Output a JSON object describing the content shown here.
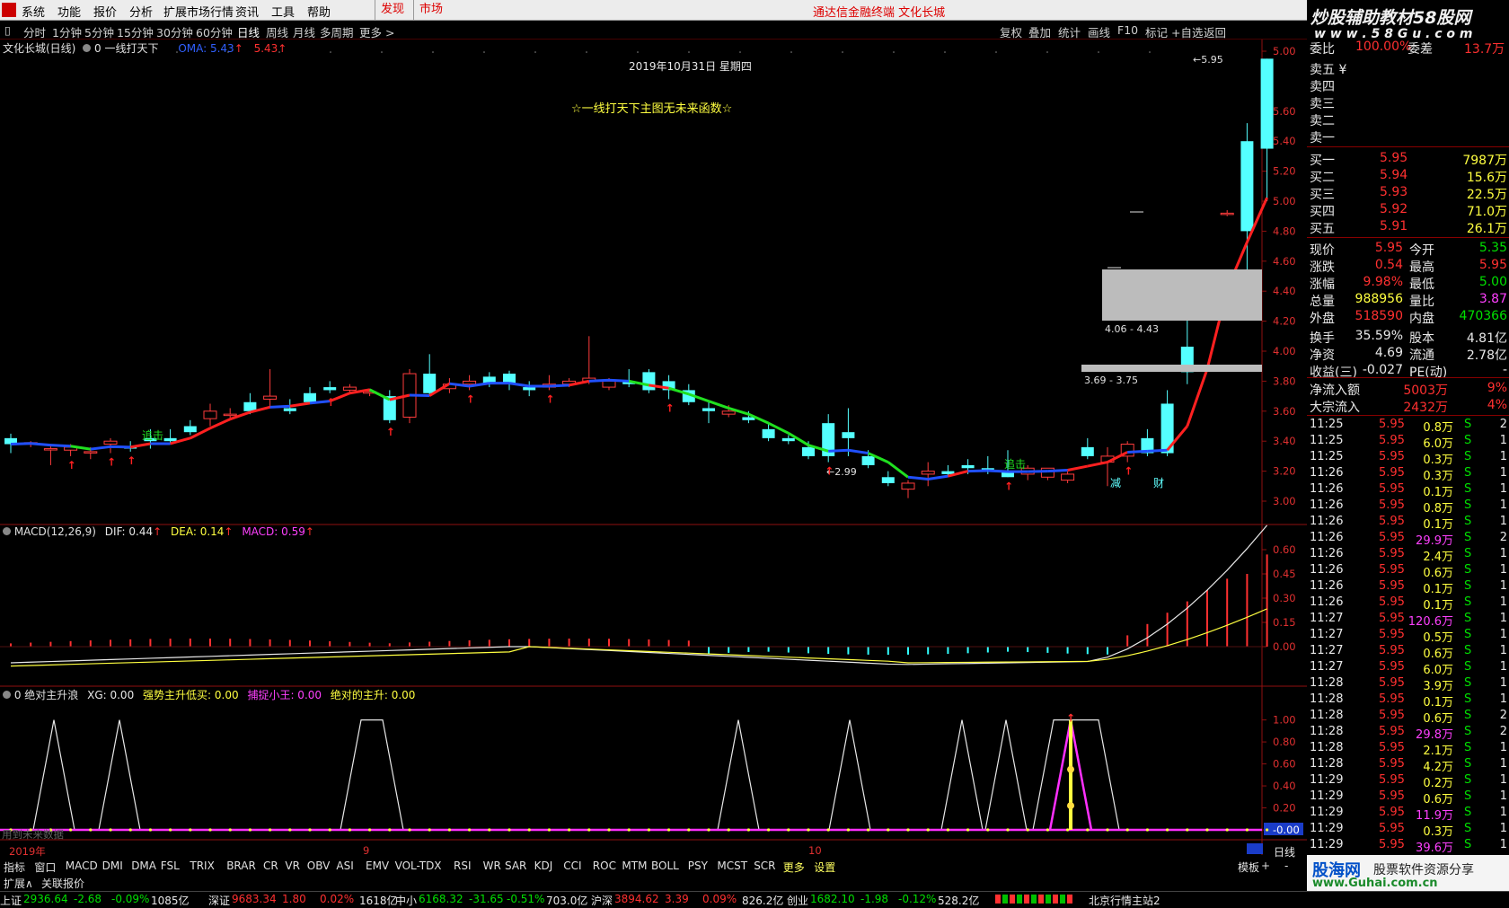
{
  "menu": {
    "items": [
      "系统",
      "功能",
      "报价",
      "分析",
      "扩展市场行情",
      "资讯",
      "工具",
      "帮助"
    ],
    "discover": "发现",
    "market": "市场",
    "title": "通达信金融终端  文化长城"
  },
  "toolbar": {
    "tabs": [
      "分时",
      "1分钟",
      "5分钟",
      "15分钟",
      "30分钟",
      "60分钟",
      "日线",
      "周线",
      "月线",
      "多周期",
      "更多 >"
    ],
    "active": "日线",
    "right": [
      "复权",
      "叠加",
      "统计",
      "画线",
      "F10",
      "标记",
      "+自选",
      "返回"
    ]
  },
  "main_panel": {
    "stock": "文化长城(日线)",
    "formula": "0 一线打天下",
    "oma_label": "OMA: 5.43",
    "oma_value": "5.43",
    "date": "2019年10月31日  星期四",
    "notice": "☆一线打天下主图无未来函数☆",
    "y_ticks": [
      "5.00",
      "5.60",
      "5.40",
      "5.20",
      "5.00",
      "4.80",
      "4.60",
      "4.40",
      "4.20",
      "4.00",
      "3.80",
      "3.60",
      "3.40",
      "3.20",
      "3.00"
    ],
    "annotations": {
      "high": "5.95",
      "low": "2.99",
      "zone1": "4.06 - 4.43",
      "zone2": "3.69 - 3.75",
      "chase": "追击",
      "sig1": "减",
      "sig2": "财"
    }
  },
  "macd_panel": {
    "title": "MACD(12,26,9)",
    "dif": "DIF: 0.44",
    "dea": "DEA: 0.14",
    "macd": "MACD: 0.59",
    "y_ticks": [
      "0.60",
      "0.45",
      "0.30",
      "0.15",
      "0.00"
    ]
  },
  "xg_panel": {
    "title": "0 绝对主升浪",
    "xg": "XG: 0.00",
    "strong": "强势主升低买: 0.00",
    "catch": "捕捉小王: 0.00",
    "abs": "绝对的主升: 0.00",
    "y_ticks": [
      "1.00",
      "0.80",
      "0.60",
      "0.40",
      "0.20",
      "-0.00"
    ],
    "note": "用到未来数据"
  },
  "x_axis": {
    "labels": [
      "2019年",
      "9",
      "10"
    ],
    "period": "日线"
  },
  "bottom_tabs": [
    "指标",
    "窗口",
    "MACD",
    "DMI",
    "DMA",
    "FSL",
    "TRIX",
    "BRAR",
    "CR",
    "VR",
    "OBV",
    "ASI",
    "EMV",
    "VOL-TDX",
    "RSI",
    "WR",
    "SAR",
    "KDJ",
    "CCI",
    "ROC",
    "MTM",
    "BOLL",
    "PSY",
    "MCST",
    "SCR",
    "更多",
    "设置"
  ],
  "bottom_right": [
    "模板",
    "+",
    "-"
  ],
  "ext": [
    "扩展∧",
    "关联报价"
  ],
  "banner": {
    "line1": "炒股辅助教材58股网",
    "line2": "w w w . 5 8 G u . c o m"
  },
  "order_book": {
    "header": [
      "委比",
      "100.00%",
      "委差",
      "13.7万"
    ],
    "sells": [
      "卖五 ¥",
      "卖四",
      "卖三",
      "卖二",
      "卖一"
    ],
    "buys": [
      {
        "label": "买一",
        "price": "5.95",
        "vol": "7987万"
      },
      {
        "label": "买二",
        "price": "5.94",
        "vol": "15.6万"
      },
      {
        "label": "买三",
        "price": "5.93",
        "vol": "22.5万"
      },
      {
        "label": "买四",
        "price": "5.92",
        "vol": "71.0万"
      },
      {
        "label": "买五",
        "price": "5.91",
        "vol": "26.1万"
      }
    ]
  },
  "quote": [
    {
      "l1": "现价",
      "v1": "5.95",
      "l2": "今开",
      "v2": "5.35"
    },
    {
      "l1": "涨跌",
      "v1": "0.54",
      "l2": "最高",
      "v2": "5.95"
    },
    {
      "l1": "涨幅",
      "v1": "9.98%",
      "l2": "最低",
      "v2": "5.00"
    },
    {
      "l1": "总量",
      "v1": "988956",
      "l2": "量比",
      "v2": "3.87"
    },
    {
      "l1": "外盘",
      "v1": "518590",
      "l2": "内盘",
      "v2": "470366"
    },
    {
      "l1": "换手",
      "v1": "35.59%",
      "l2": "股本",
      "v2": "4.81亿"
    },
    {
      "l1": "净资",
      "v1": "4.69",
      "l2": "流通",
      "v2": "2.78亿"
    },
    {
      "l1": "收益(三)",
      "v1": "-0.027",
      "l2": "PE(动)",
      "v2": "-"
    }
  ],
  "flows": [
    {
      "label": "净流入额",
      "value": "5003万",
      "pct": "9%"
    },
    {
      "label": "大宗流入",
      "value": "2432万",
      "pct": "4%"
    }
  ],
  "ticks": [
    {
      "t": "11:25",
      "p": "5.95",
      "v": "0.8万",
      "s": "S",
      "n": "2"
    },
    {
      "t": "11:25",
      "p": "5.95",
      "v": "6.0万",
      "s": "S",
      "n": "1"
    },
    {
      "t": "11:25",
      "p": "5.95",
      "v": "0.3万",
      "s": "S",
      "n": "1"
    },
    {
      "t": "11:26",
      "p": "5.95",
      "v": "0.3万",
      "s": "S",
      "n": "1"
    },
    {
      "t": "11:26",
      "p": "5.95",
      "v": "0.1万",
      "s": "S",
      "n": "1"
    },
    {
      "t": "11:26",
      "p": "5.95",
      "v": "0.8万",
      "s": "S",
      "n": "1"
    },
    {
      "t": "11:26",
      "p": "5.95",
      "v": "0.1万",
      "s": "S",
      "n": "1"
    },
    {
      "t": "11:26",
      "p": "5.95",
      "v": "29.9万",
      "s": "S",
      "n": "2"
    },
    {
      "t": "11:26",
      "p": "5.95",
      "v": "2.4万",
      "s": "S",
      "n": "1"
    },
    {
      "t": "11:26",
      "p": "5.95",
      "v": "0.6万",
      "s": "S",
      "n": "1"
    },
    {
      "t": "11:26",
      "p": "5.95",
      "v": "0.1万",
      "s": "S",
      "n": "1"
    },
    {
      "t": "11:26",
      "p": "5.95",
      "v": "0.1万",
      "s": "S",
      "n": "1"
    },
    {
      "t": "11:27",
      "p": "5.95",
      "v": "120.6万",
      "s": "S",
      "n": "1"
    },
    {
      "t": "11:27",
      "p": "5.95",
      "v": "0.5万",
      "s": "S",
      "n": "1"
    },
    {
      "t": "11:27",
      "p": "5.95",
      "v": "0.6万",
      "s": "S",
      "n": "1"
    },
    {
      "t": "11:27",
      "p": "5.95",
      "v": "6.0万",
      "s": "S",
      "n": "1"
    },
    {
      "t": "11:28",
      "p": "5.95",
      "v": "3.9万",
      "s": "S",
      "n": "1"
    },
    {
      "t": "11:28",
      "p": "5.95",
      "v": "0.1万",
      "s": "S",
      "n": "1"
    },
    {
      "t": "11:28",
      "p": "5.95",
      "v": "0.6万",
      "s": "S",
      "n": "2"
    },
    {
      "t": "11:28",
      "p": "5.95",
      "v": "29.8万",
      "s": "S",
      "n": "2"
    },
    {
      "t": "11:28",
      "p": "5.95",
      "v": "2.1万",
      "s": "S",
      "n": "1"
    },
    {
      "t": "11:28",
      "p": "5.95",
      "v": "4.2万",
      "s": "S",
      "n": "1"
    },
    {
      "t": "11:29",
      "p": "5.95",
      "v": "0.2万",
      "s": "S",
      "n": "1"
    },
    {
      "t": "11:29",
      "p": "5.95",
      "v": "0.6万",
      "s": "S",
      "n": "1"
    },
    {
      "t": "11:29",
      "p": "5.95",
      "v": "11.9万",
      "s": "S",
      "n": "1"
    },
    {
      "t": "11:29",
      "p": "5.95",
      "v": "0.3万",
      "s": "S",
      "n": "1"
    },
    {
      "t": "11:29",
      "p": "5.95",
      "v": "39.6万",
      "s": "S",
      "n": "1"
    }
  ],
  "status": {
    "sh": [
      "上证",
      "2936.64",
      "-2.68",
      "-0.09%",
      "1085亿"
    ],
    "sz": [
      "深证",
      "9683.34",
      "1.80",
      "0.02%",
      "1618亿"
    ],
    "zx": [
      "中小",
      "6168.32",
      "-31.65",
      "-0.51%",
      "703.0亿"
    ],
    "hs": [
      "沪深",
      "3894.62",
      "3.39",
      "0.09%",
      "826.2亿"
    ],
    "cy": [
      "创业",
      "1682.10",
      "-1.98",
      "-0.12%",
      "528.2亿"
    ],
    "server": "北京行情主站2"
  },
  "watermark": {
    "brand": "股海网",
    "slogan": "股票软件资源分享",
    "url": "www.Guhai.com.cn"
  },
  "chart_data": {
    "type": "candlestick",
    "ohlc": [
      [
        3.42,
        3.45,
        3.32,
        3.38
      ],
      [
        3.38,
        3.4,
        3.36,
        3.39
      ],
      [
        3.35,
        3.38,
        3.24,
        3.35
      ],
      [
        3.34,
        3.38,
        3.3,
        3.36
      ],
      [
        3.33,
        3.36,
        3.28,
        3.33
      ],
      [
        3.38,
        3.42,
        3.32,
        3.4
      ],
      [
        3.36,
        3.4,
        3.33,
        3.35
      ],
      [
        3.42,
        3.48,
        3.35,
        3.4
      ],
      [
        3.42,
        3.48,
        3.38,
        3.4
      ],
      [
        3.5,
        3.54,
        3.44,
        3.46
      ],
      [
        3.55,
        3.65,
        3.5,
        3.6
      ],
      [
        3.58,
        3.62,
        3.55,
        3.58
      ],
      [
        3.66,
        3.72,
        3.58,
        3.6
      ],
      [
        3.68,
        3.88,
        3.62,
        3.7
      ],
      [
        3.62,
        3.68,
        3.58,
        3.6
      ],
      [
        3.72,
        3.76,
        3.65,
        3.66
      ],
      [
        3.76,
        3.8,
        3.72,
        3.74
      ],
      [
        3.74,
        3.78,
        3.72,
        3.76
      ],
      [
        3.72,
        3.75,
        3.7,
        3.73
      ],
      [
        3.7,
        3.74,
        3.52,
        3.54
      ],
      [
        3.56,
        3.88,
        3.52,
        3.85
      ],
      [
        3.85,
        3.98,
        3.7,
        3.72
      ],
      [
        3.75,
        3.82,
        3.72,
        3.78
      ],
      [
        3.78,
        3.84,
        3.74,
        3.8
      ],
      [
        3.83,
        3.86,
        3.76,
        3.78
      ],
      [
        3.85,
        3.87,
        3.74,
        3.78
      ],
      [
        3.76,
        3.8,
        3.7,
        3.74
      ],
      [
        3.76,
        3.84,
        3.74,
        3.78
      ],
      [
        3.78,
        3.82,
        3.76,
        3.8
      ],
      [
        3.8,
        4.1,
        3.78,
        3.82
      ],
      [
        3.76,
        3.82,
        3.74,
        3.8
      ],
      [
        3.8,
        3.88,
        3.76,
        3.78
      ],
      [
        3.86,
        3.88,
        3.72,
        3.74
      ],
      [
        3.8,
        3.84,
        3.68,
        3.74
      ],
      [
        3.74,
        3.78,
        3.64,
        3.66
      ],
      [
        3.62,
        3.66,
        3.52,
        3.6
      ],
      [
        3.58,
        3.64,
        3.56,
        3.6
      ],
      [
        3.56,
        3.6,
        3.52,
        3.54
      ],
      [
        3.48,
        3.52,
        3.4,
        3.42
      ],
      [
        3.42,
        3.44,
        3.38,
        3.4
      ],
      [
        3.36,
        3.4,
        3.28,
        3.3
      ],
      [
        3.52,
        3.58,
        3.26,
        3.3
      ],
      [
        3.46,
        3.62,
        3.3,
        3.42
      ],
      [
        3.3,
        3.34,
        3.22,
        3.24
      ],
      [
        3.16,
        3.2,
        3.1,
        3.12
      ],
      [
        3.08,
        3.14,
        3.02,
        3.12
      ],
      [
        3.18,
        3.26,
        3.1,
        3.2
      ],
      [
        3.2,
        3.24,
        3.16,
        3.18
      ],
      [
        3.24,
        3.28,
        3.18,
        3.22
      ],
      [
        3.22,
        3.3,
        3.18,
        3.21
      ],
      [
        3.2,
        3.34,
        3.16,
        3.16
      ],
      [
        3.18,
        3.24,
        3.14,
        3.22
      ],
      [
        3.16,
        3.22,
        3.14,
        3.22
      ],
      [
        3.14,
        3.2,
        3.12,
        3.18
      ],
      [
        3.36,
        3.42,
        3.28,
        3.3
      ],
      [
        3.26,
        3.36,
        3.1,
        3.3
      ],
      [
        3.3,
        3.4,
        3.26,
        3.38
      ],
      [
        3.42,
        3.48,
        3.3,
        3.32
      ],
      [
        3.65,
        3.74,
        3.3,
        3.32
      ],
      [
        4.03,
        4.22,
        3.78,
        3.86
      ],
      [
        4.46,
        4.48,
        4.42,
        4.46
      ],
      [
        4.92,
        4.94,
        4.9,
        4.92
      ],
      [
        5.4,
        5.52,
        4.46,
        4.8
      ],
      [
        5.95,
        5.95,
        5.0,
        5.35
      ]
    ],
    "y_range": [
      2.9,
      6.0
    ]
  }
}
